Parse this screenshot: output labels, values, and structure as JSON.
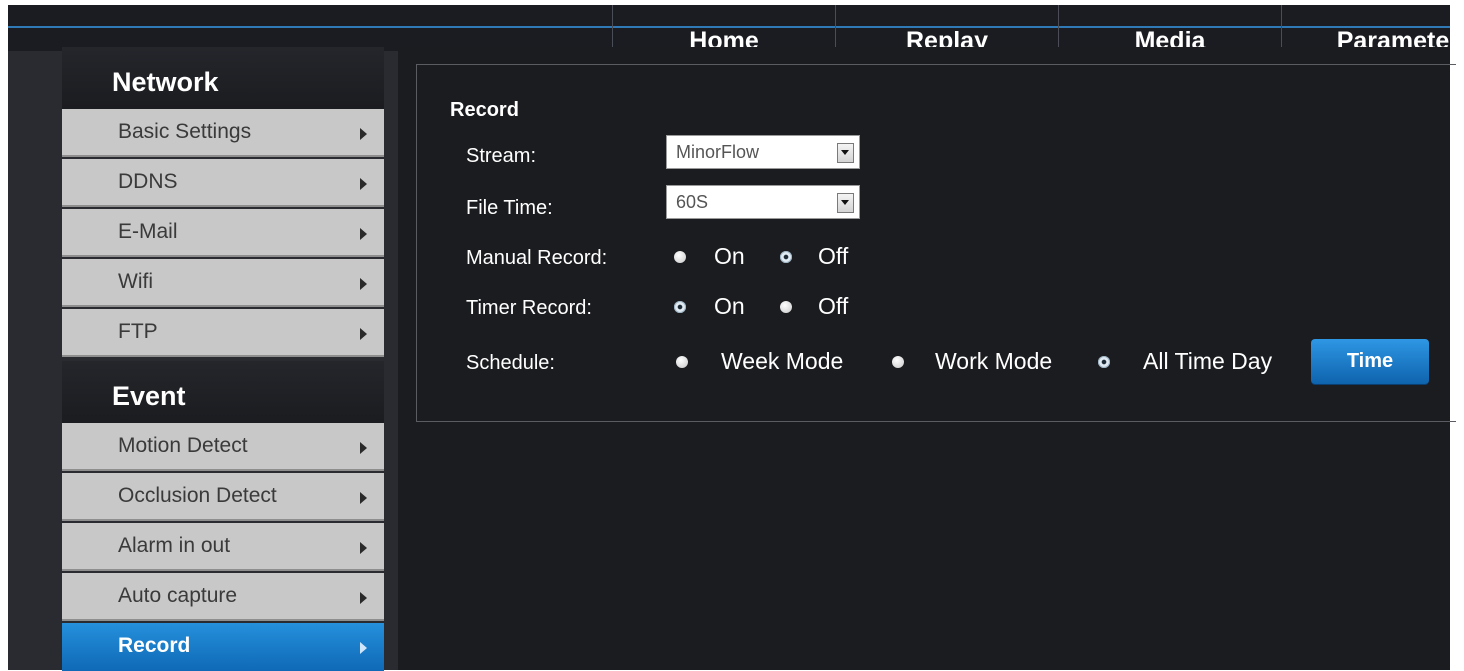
{
  "topnav": {
    "tabs": [
      {
        "label": "Home"
      },
      {
        "label": "Replay"
      },
      {
        "label": "Media"
      },
      {
        "label": "Paramete"
      }
    ]
  },
  "sidebar": {
    "sections": [
      {
        "title": "Network",
        "items": [
          {
            "label": "Basic Settings"
          },
          {
            "label": "DDNS"
          },
          {
            "label": "E-Mail"
          },
          {
            "label": "Wifi"
          },
          {
            "label": "FTP"
          }
        ]
      },
      {
        "title": "Event",
        "items": [
          {
            "label": "Motion Detect"
          },
          {
            "label": "Occlusion Detect"
          },
          {
            "label": "Alarm in out"
          },
          {
            "label": "Auto capture"
          },
          {
            "label": "Record",
            "active": true
          }
        ]
      }
    ]
  },
  "record": {
    "title": "Record",
    "stream": {
      "label": "Stream:",
      "value": "MinorFlow"
    },
    "file_time": {
      "label": "File Time:",
      "value": "60S"
    },
    "manual_record": {
      "label": "Manual Record:",
      "on_label": "On",
      "off_label": "Off",
      "selected": "Off"
    },
    "timer_record": {
      "label": "Timer Record:",
      "on_label": "On",
      "off_label": "Off",
      "selected": "On"
    },
    "schedule": {
      "label": "Schedule:",
      "options": [
        "Week Mode",
        "Work Mode",
        "All Time Day"
      ],
      "selected": "All Time Day",
      "time_button": "Time"
    }
  },
  "colors": {
    "accent": "#2f79b6",
    "active_menu": "#1a7fd0",
    "background": "#1b1c20"
  }
}
